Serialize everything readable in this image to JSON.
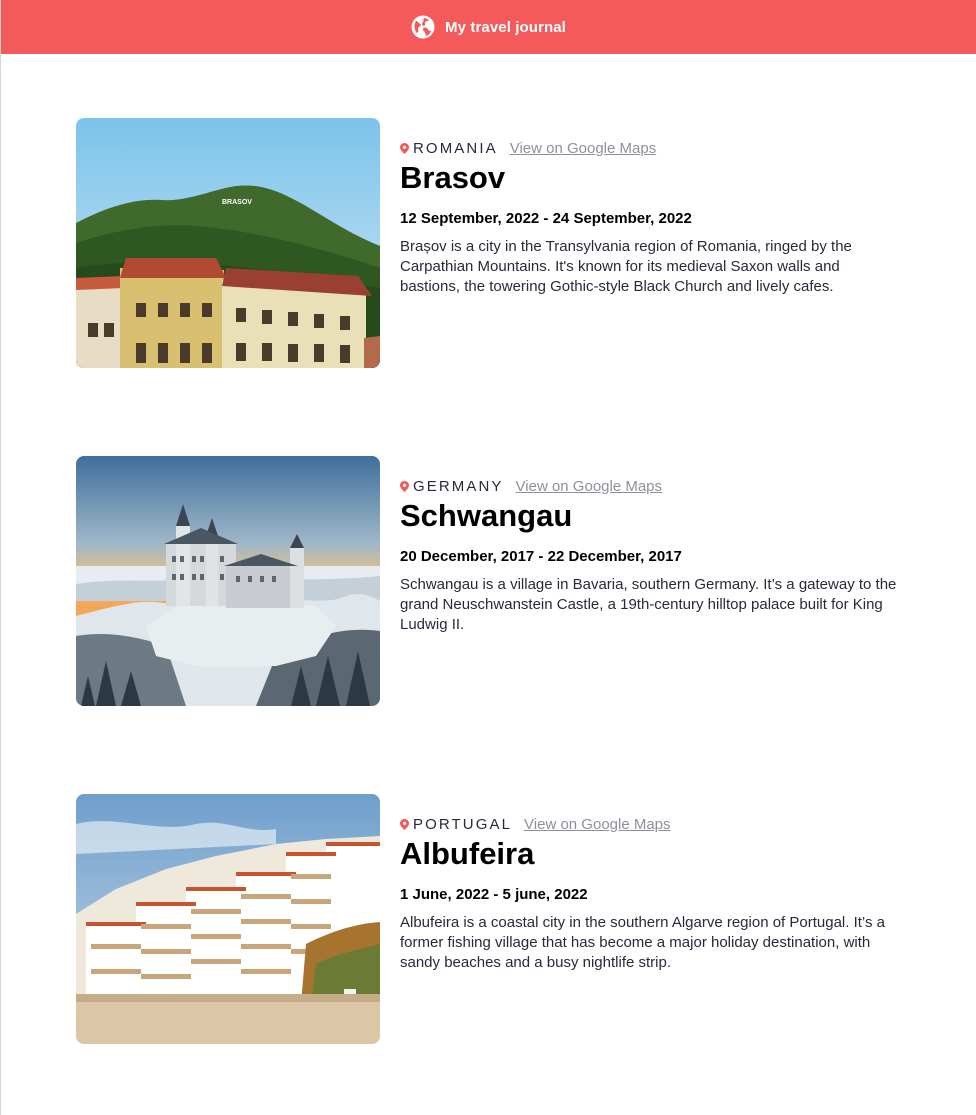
{
  "header": {
    "title": "My travel journal",
    "icon": "globe-icon"
  },
  "entries": [
    {
      "country": "ROMANIA",
      "maps_label": "View on Google Maps",
      "title": "Brasov",
      "dates": "12 September, 2022 - 24 September, 2022",
      "description": "Brașov is a city in the Transylvania region of Romania, ringed by the Carpathian Mountains. It's known for its medieval Saxon walls and bastions, the towering Gothic-style Black Church and lively cafes.",
      "sign": "BRASOV"
    },
    {
      "country": "GERMANY",
      "maps_label": "View on Google Maps",
      "title": "Schwangau",
      "dates": "20 December, 2017 - 22 December, 2017",
      "description": "Schwangau is a village in Bavaria, southern Germany. It’s a gateway to the grand Neuschwanstein Castle, a 19th-century hilltop palace built for King Ludwig II."
    },
    {
      "country": "PORTUGAL",
      "maps_label": "View on Google Maps",
      "title": "Albufeira",
      "dates": "1 June, 2022 - 5 june, 2022",
      "description": "Albufeira is a coastal city in the southern Algarve region of Portugal. It’s a former fishing village that has become a major holiday destination, with sandy beaches and a busy nightlife strip."
    }
  ],
  "colors": {
    "accent": "#f55a5a",
    "link": "#918e9b",
    "text": "#2b283a"
  }
}
